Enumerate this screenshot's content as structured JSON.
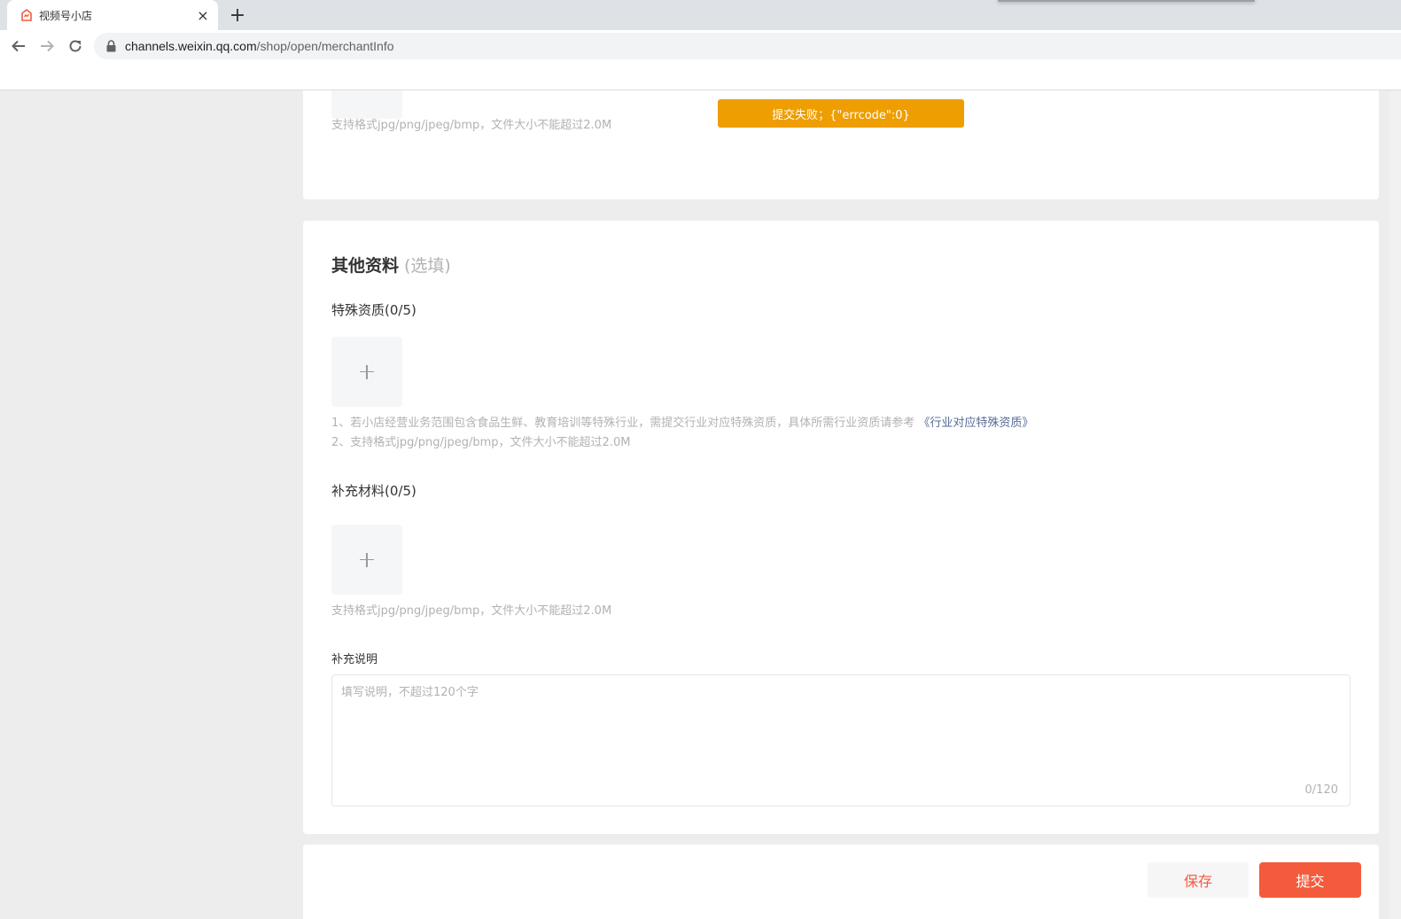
{
  "browser": {
    "tab_title": "视频号小店",
    "tab_close": "×",
    "new_tab": "+",
    "url_host": "channels.weixin.qq.com",
    "url_path": "/shop/open/merchantInfo"
  },
  "upload_prev": {
    "hint": "支持格式jpg/png/jpeg/bmp，文件大小不能超过2.0M"
  },
  "toast": {
    "message": "提交失败；{\"errcode\":0}",
    "color": "#ee9e00"
  },
  "other_info": {
    "title": "其他资料",
    "optional": "(选填)",
    "special_qual": {
      "label": "特殊资质(0/5)",
      "hint_line1": "1、若小店经营业务范围包含食品生鲜、教育培训等特殊行业，需提交行业对应特殊资质，具体所需行业资质请参考",
      "hint_link": "《行业对应特殊资质》",
      "hint_line2": "2、支持格式jpg/png/jpeg/bmp，文件大小不能超过2.0M"
    },
    "supplement_material": {
      "label": "补充材料(0/5)",
      "hint": "支持格式jpg/png/jpeg/bmp，文件大小不能超过2.0M"
    },
    "supplement_note": {
      "label": "补充说明",
      "placeholder": "填写说明，不超过120个字",
      "value": "",
      "counter": "0/120"
    }
  },
  "footer": {
    "save_label": "保存",
    "submit_label": "提交",
    "accent_color": "#f45b3c"
  },
  "icons": [
    "tab-favicon-icon",
    "close-icon",
    "plus-icon",
    "back-arrow-icon",
    "forward-arrow-icon",
    "reload-icon",
    "lock-icon",
    "add-image-plus-icon"
  ]
}
